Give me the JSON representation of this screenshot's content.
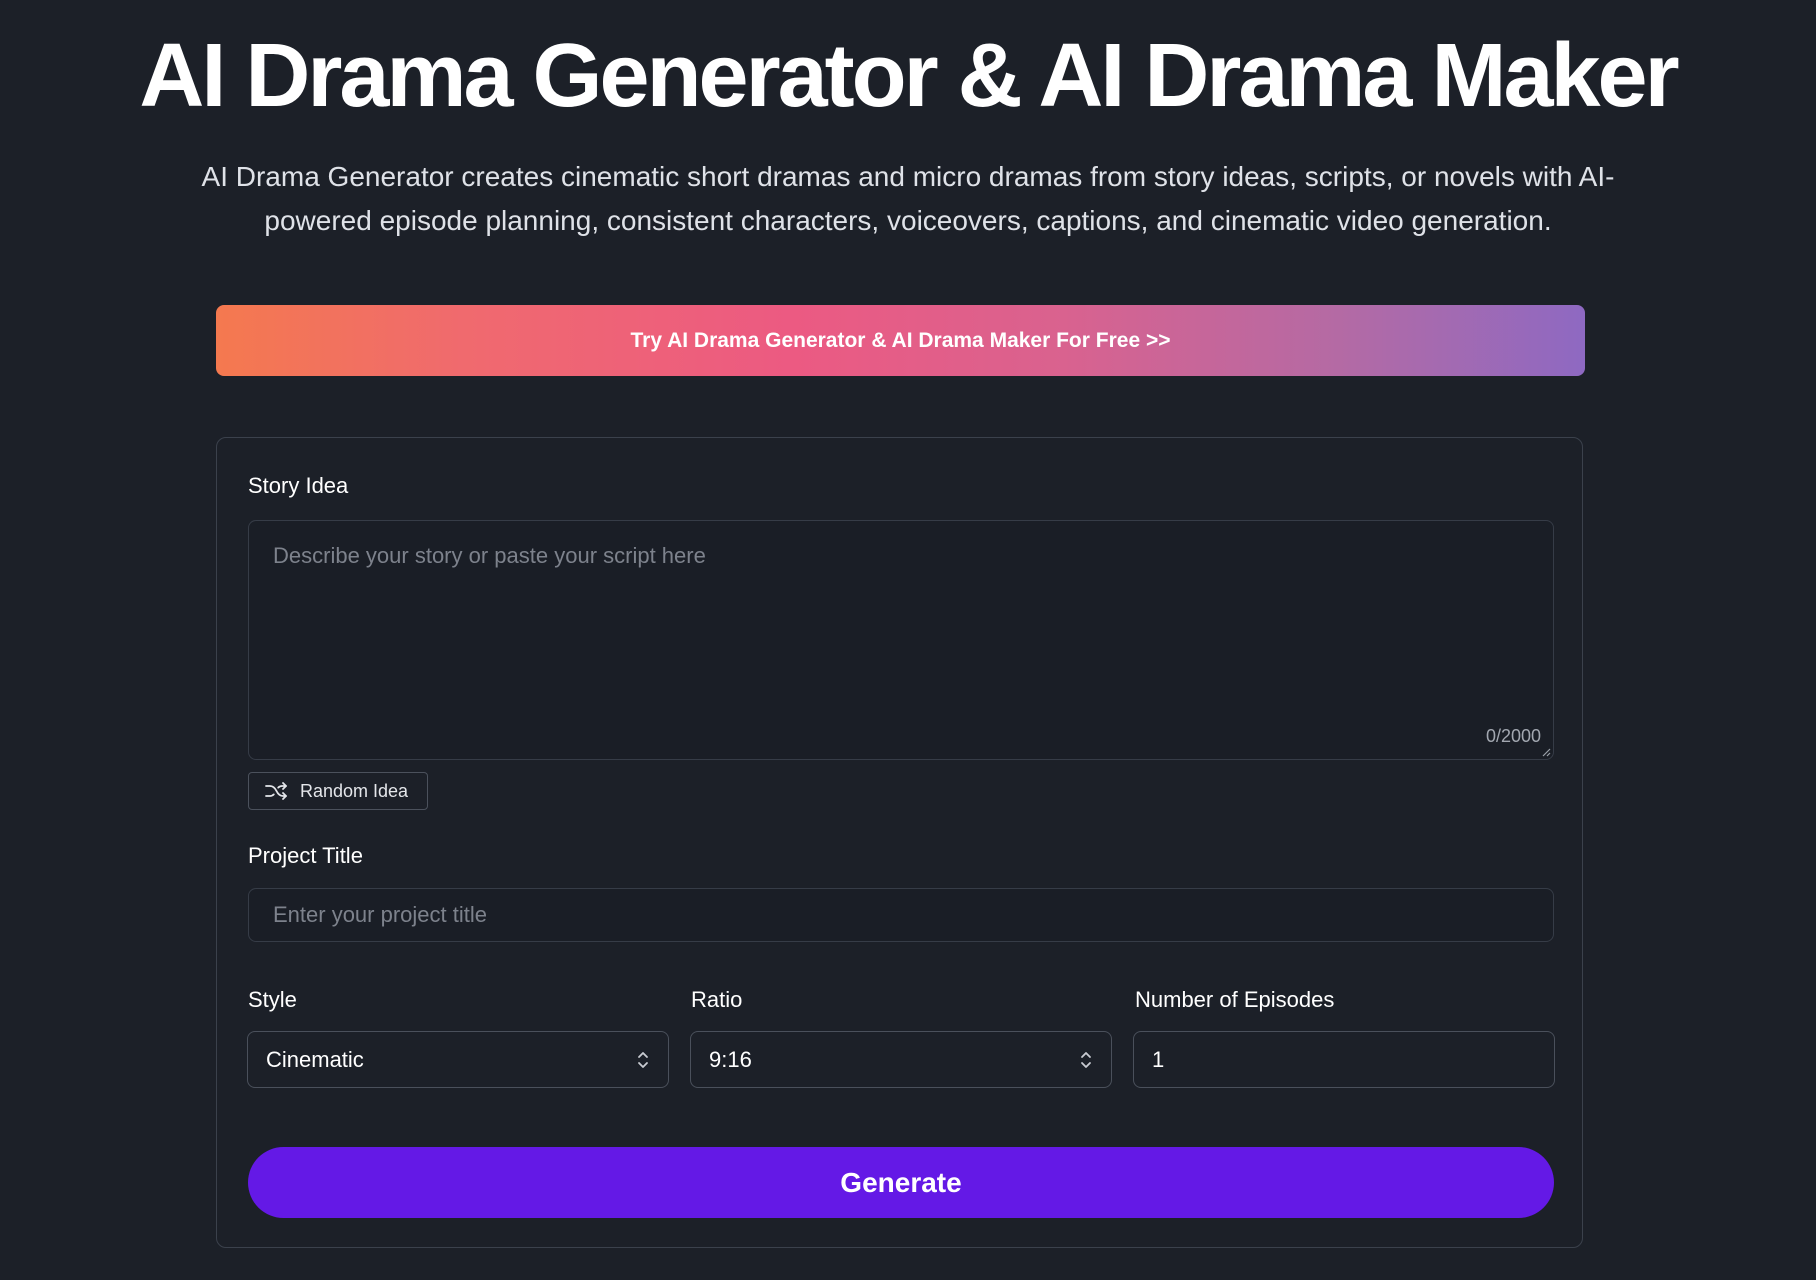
{
  "hero": {
    "title": "AI Drama Generator & AI Drama Maker",
    "subtitle": "AI Drama Generator creates cinematic short dramas and micro dramas from story ideas, scripts, or novels with AI-powered episode planning, consistent characters, voiceovers, captions, and cinematic video generation."
  },
  "cta": {
    "label": "Try AI Drama Generator & AI Drama Maker For Free >>",
    "gradient_colors": [
      "#f4794f",
      "#ec5a82",
      "#8e69c2"
    ]
  },
  "form": {
    "story_idea": {
      "label": "Story Idea",
      "placeholder": "Describe your story or paste your script here",
      "value": "",
      "counter": "0/2000"
    },
    "random_idea": {
      "label": "Random Idea",
      "icon": "shuffle-icon"
    },
    "project_title": {
      "label": "Project Title",
      "placeholder": "Enter your project title",
      "value": ""
    },
    "style": {
      "label": "Style",
      "value": "Cinematic",
      "icon": "chevron-up-down-icon"
    },
    "ratio": {
      "label": "Ratio",
      "value": "9:16",
      "icon": "chevron-up-down-icon"
    },
    "episodes": {
      "label": "Number of Episodes",
      "value": "1"
    },
    "generate": {
      "label": "Generate",
      "color": "#6419e6"
    }
  },
  "colors": {
    "background": "#1c2028",
    "border": "#3b414c",
    "placeholder_text": "#7d828c"
  }
}
